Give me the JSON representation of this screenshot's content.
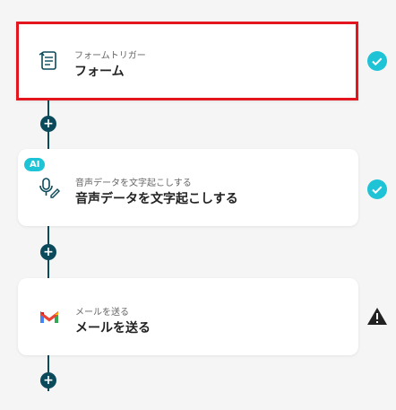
{
  "steps": [
    {
      "small": "フォームトリガー",
      "big": "フォーム",
      "icon": "form-icon",
      "status": "check-icon"
    },
    {
      "small": "音声データを文字起こしする",
      "big": "音声データを文字起こしする",
      "icon": "microphone-edit-icon",
      "status": "check-icon",
      "badge": "AI"
    },
    {
      "small": "メールを送る",
      "big": "メールを送る",
      "icon": "gmail-icon",
      "status": "warning-icon"
    }
  ],
  "colors": {
    "accent": "#0b4a5a",
    "check": "#1ec3d6",
    "selected_border": "#e3161f"
  }
}
